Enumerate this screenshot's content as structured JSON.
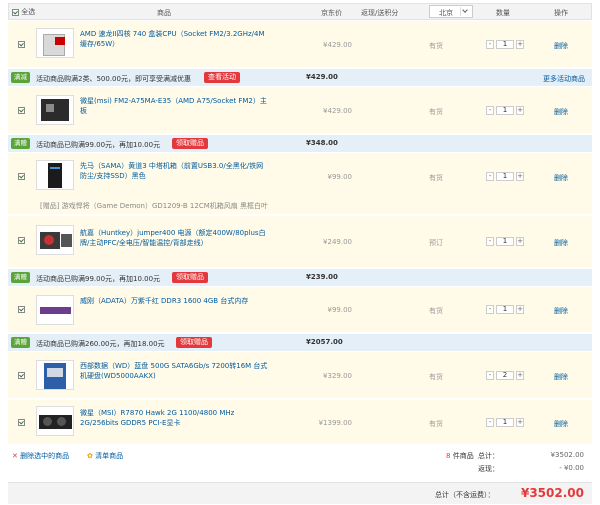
{
  "header": {
    "select_all": "全选",
    "col_product": "商品",
    "col_price": "京东价",
    "col_cashback": "返现/送积分",
    "city": "北京",
    "col_qty": "数量",
    "col_ops": "操作"
  },
  "items": [
    {
      "name": "AMD 速龙II四核 740 盒装CPU（Socket FM2/3.2GHz/4M缓存/65W）",
      "price": "¥429.00",
      "stock": "有货",
      "qty": "1",
      "delete": "删除",
      "thumb": "cpu-box"
    },
    {
      "name": "微星(msi) FM2-A75MA-E35（AMD A75/Socket FM2）主板",
      "price": "¥429.00",
      "stock": "有货",
      "qty": "1",
      "delete": "删除",
      "thumb": "motherboard"
    },
    {
      "name": "先马（SAMA）黄道3 中塔机箱（前置USB3.0/全黑化/铁网防尘/支持SSD）黑色",
      "price": "¥99.00",
      "stock": "有货",
      "qty": "1",
      "delete": "删除",
      "thumb": "case",
      "sub": "[赠品] 游戏悍将（Game Demon）GD1209-B 12CM机箱风扇 黑框白叶"
    },
    {
      "name": "航嘉（Huntkey）jumper400 电源（额定400W/80plus白牌/主动PFC/全电压/智能温控/背部走线）",
      "price": "¥249.00",
      "stock": "预订",
      "qty": "1",
      "delete": "删除",
      "thumb": "psu"
    },
    {
      "name": "威刚（ADATA）万紫千红 DDR3 1600 4GB 台式内存",
      "price": "¥99.00",
      "stock": "有货",
      "qty": "1",
      "delete": "删除",
      "thumb": "ram"
    },
    {
      "name": "西部数据（WD）蓝盘 500G SATA6Gb/s 7200转16M 台式机硬盘(WD5000AAKX)",
      "price": "¥329.00",
      "stock": "有货",
      "qty": "2",
      "delete": "删除",
      "thumb": "hdd"
    },
    {
      "name": "微星（MSI）R7870 Hawk 2G 1100/4800 MHz 2G/256bits GDDR5 PCI-E显卡",
      "price": "¥1399.00",
      "stock": "有货",
      "qty": "1",
      "delete": "删除",
      "thumb": "gpu"
    }
  ],
  "promos": [
    {
      "tag": "满减",
      "text": "活动商品购满2类、500.00元，即可享受满减优惠",
      "button": "查看活动",
      "total": "¥429.00",
      "link": "更多活动商品"
    },
    {
      "tag": "满赠",
      "text": "活动商品已购满99.00元，再加10.00元",
      "button": "领取赠品",
      "total": "¥348.00"
    },
    {
      "tag": "满赠",
      "text": "活动商品已购满99.00元，再加10.00元",
      "button": "领取赠品",
      "total": "¥239.00"
    },
    {
      "tag": "满赠",
      "text": "活动商品已购满260.00元，再加18.00元",
      "button": "领取赠品",
      "total": "¥2057.00"
    }
  ],
  "footer": {
    "delete_selected": "删除选中的商品",
    "clear_cart": "清单商品",
    "count_num": "8",
    "count_label": "件商品",
    "total_label": "总计：",
    "total_value": "¥3502.00",
    "cashback_label": "返现：",
    "cashback_value": "- ¥0.00",
    "grand_label": "总计（不含运费）：",
    "grand_value": "¥3502.00"
  },
  "colors": {
    "accent": "#e4393c",
    "link": "#005aa0",
    "promo_bg": "#e4eff8",
    "item_bg": "#fffbe8",
    "tag_bg": "#5aa43a"
  }
}
